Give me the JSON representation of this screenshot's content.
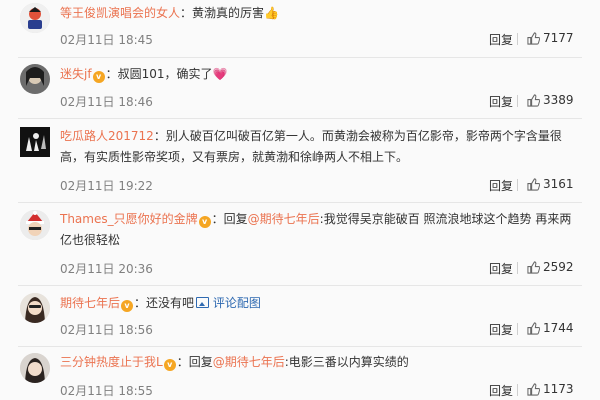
{
  "comments": [
    {
      "user": "等王俊凯演唱会的女人",
      "vip": false,
      "text": "：黄渤真的厉害",
      "emoji": "👍",
      "time": "02月11日 18:45",
      "reply_label": "回复",
      "likes": "7177"
    },
    {
      "user": "迷失jf",
      "vip": true,
      "text": "：叔圆101，确实了",
      "emoji": "💗",
      "time": "02月11日 18:46",
      "reply_label": "回复",
      "likes": "3389"
    },
    {
      "user": "吃瓜路人201712",
      "vip": false,
      "text_line1": "：别人破百亿叫破百亿第一人。而黄渤会被称为百亿影帝，影帝两个字含量很",
      "text_line2": "高，有实质性影帝奖项，又有票房，就黄渤和徐峥两人不相上下。",
      "time": "02月11日 19:22",
      "reply_label": "回复",
      "likes": "3161"
    },
    {
      "user": "Thames_只愿你好的金牌",
      "vip": true,
      "prefix": "：回复",
      "mention": "@期待七年后",
      "text_line1": ":我觉得吴京能破百 照流浪地球这个趋势 再来两",
      "text_line2": "亿也很轻松",
      "time": "02月11日 20:36",
      "reply_label": "回复",
      "likes": "2592"
    },
    {
      "user": "期待七年后",
      "vip": true,
      "text": "：还没有吧",
      "link": "评论配图",
      "time": "02月11日 18:56",
      "reply_label": "回复",
      "likes": "1744"
    },
    {
      "user": "三分钟热度止于我L",
      "vip": true,
      "prefix": "：回复",
      "mention": "@期待七年后",
      "text": ":电影三番以内算实绩的",
      "time": "02月11日 18:55",
      "reply_label": "回复",
      "likes": "1173"
    }
  ],
  "icons": {
    "vip": "vip-badge-icon",
    "thumb": "thumbs-up-icon",
    "picture": "picture-icon"
  },
  "colors": {
    "username": "#eb7350",
    "link": "#2f6ab1",
    "meta": "#808080",
    "vip": "#f5a623"
  }
}
